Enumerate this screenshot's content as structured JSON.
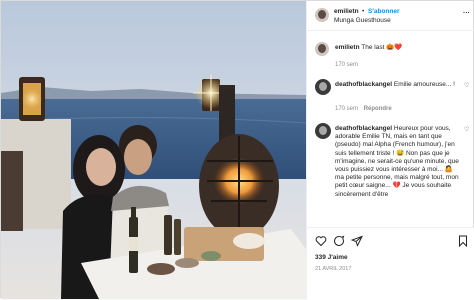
{
  "post": {
    "username": "emilietn",
    "follow_label": "S'abonner",
    "separator": "•",
    "location": "Munga Guesthouse",
    "more_label": "···"
  },
  "caption": {
    "username": "emilietn",
    "text": "The last",
    "emoji": "🎃❤️",
    "time": "170 sem"
  },
  "comments": [
    {
      "username": "deathofblackangel",
      "text": "Emilie amoureuse... !",
      "time": "170 sem",
      "reply_label": "Répondre"
    },
    {
      "username": "deathofblackangel",
      "text": "Heureux pour vous, adorable Emilie TN, mais en tant que (pseudo) mal Alpha (French humour), j'en suis tellement triste ! 😅 Non pas que je m'imagine, ne serait-ce qu'une minute, que vous puissiez vous intéresser à moi... 🤷 ma petite personne, mais malgré tout, mon petit cœur saigne... 💔 Je vous souhaite sincèrement d'être"
    }
  ],
  "footer": {
    "likes": "339 J'aime",
    "date": "21 AVRIL 2017"
  },
  "colors": {
    "link_blue": "#0095f6",
    "text": "#262626",
    "muted": "#8e8e8e",
    "border": "#dbdbdb"
  }
}
